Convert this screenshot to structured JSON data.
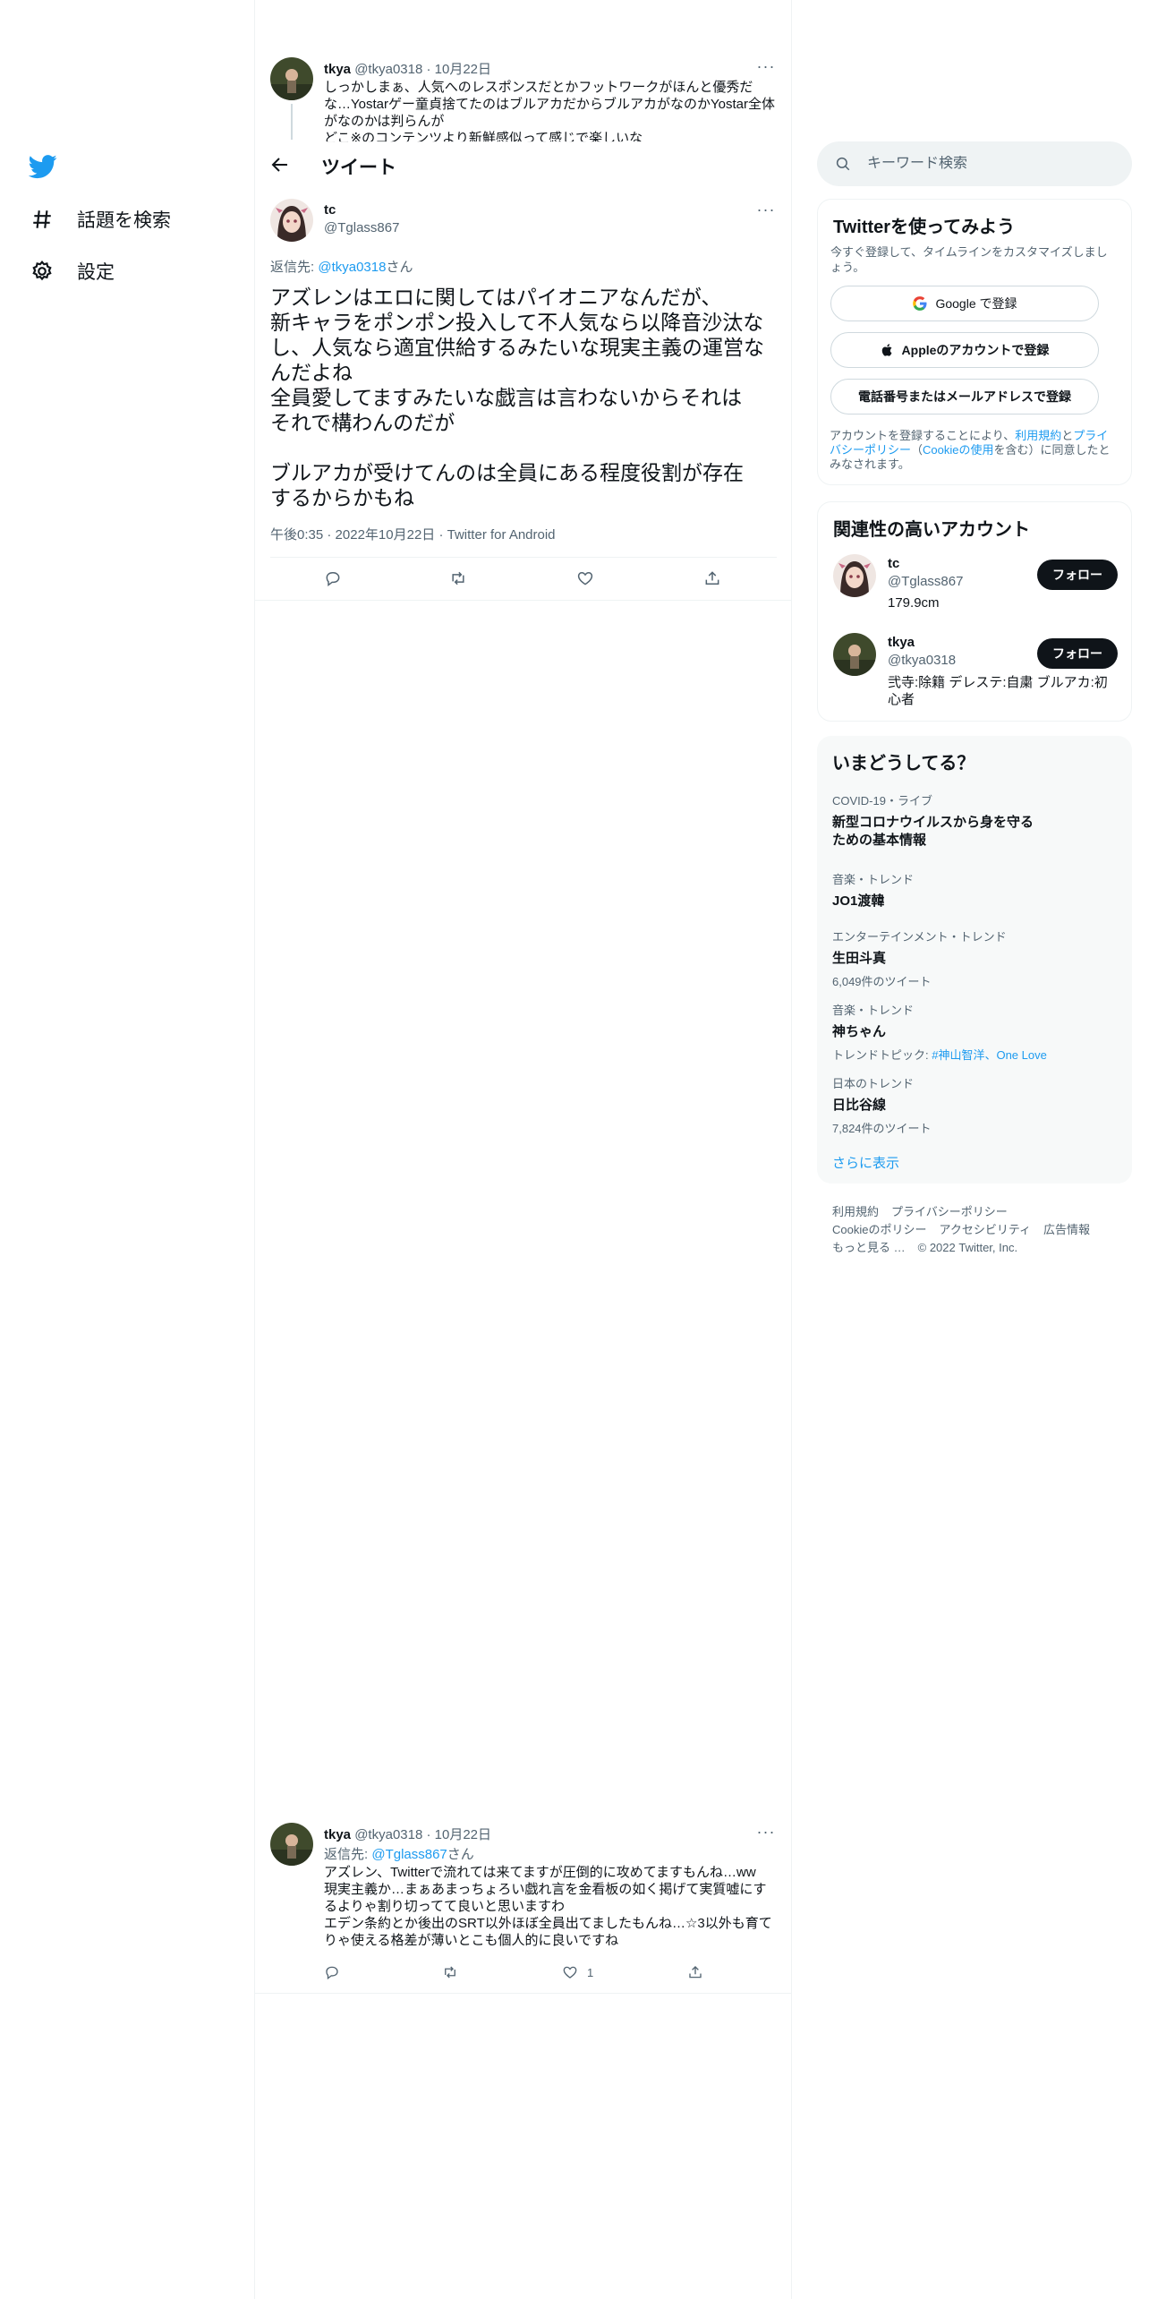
{
  "nav": {
    "explore_label": "話題を検索",
    "settings_label": "設定"
  },
  "header": {
    "title": "ツイート"
  },
  "parent_tweet": {
    "name": "tkya",
    "handle": "@tkya0318",
    "date": "10月22日",
    "lines": [
      "しっかしまぁ、人気へのレスポンスだとかフットワークがほんと優秀だ",
      "な…Yostarゲー童貞捨てたのはブルアカだからブルアカがなのかYostar全体",
      "がなのかは判らんが",
      "どこ※のコンテンツより新鮮感似って感じで楽しいな"
    ]
  },
  "main_tweet": {
    "name": "tc",
    "handle": "@Tglass867",
    "reply_prefix": "返信先: ",
    "reply_to": "@tkya0318",
    "reply_suffix": "さん",
    "lines": [
      "アズレンはエロに関してはパイオニアなんだが、",
      "新キャラをポンポン投入して不人気なら以降音沙汰な",
      "し、人気なら適宜供給するみたいな現実主義の運営な",
      "んだよね",
      "全員愛してますみたいな戯言は言わないからそれは",
      "それで構わんのだが",
      "",
      "ブルアカが受けてんのは全員にある程度役割が存在",
      "するからかもね"
    ],
    "time": "午後0:35",
    "date": "2022年10月22日",
    "source": "Twitter for Android"
  },
  "reply_tweet": {
    "name": "tkya",
    "handle": "@tkya0318",
    "date": "10月22日",
    "reply_prefix": "返信先: ",
    "reply_to": "@Tglass867",
    "reply_suffix": "さん",
    "lines": [
      "アズレン、Twitterで流れては来てますが圧倒的に攻めてますもんね…ww",
      "現実主義か…まぁあまっちょろい戯れ言を金看板の如く掲げて実質嘘にす",
      "るよりゃ割り切ってて良いと思いますわ",
      "エデン条約とか後出のSRT以外ほぼ全員出てましたもんね…☆3以外も育て",
      "りゃ使える格差が薄いとこも個人的に良いですね"
    ],
    "like_count": "1"
  },
  "search": {
    "placeholder": "キーワード検索"
  },
  "signup": {
    "title": "Twitterを使ってみよう",
    "subtitle_1": "今すぐ登録して、タイムラインをカスタマイズしまし",
    "subtitle_2": "ょう。",
    "google_label": "Google で登録",
    "apple_label": "Appleのアカウントで登録",
    "phone_label": "電話番号またはメールアドレスで登録",
    "terms_1a": "アカウントを登録することにより、",
    "terms_1b": "利用規約",
    "terms_1c": "と",
    "terms_1d": "プライ",
    "terms_2a": "バシーポリシー",
    "terms_2b": "（",
    "terms_2c": "Cookieの使用",
    "terms_2d": "を含む）に同意したと",
    "terms_3": "みなされます。"
  },
  "related": {
    "title": "関連性の高いアカウント",
    "accounts": [
      {
        "name": "tc",
        "handle": "@Tglass867",
        "bio": "179.9cm",
        "follow_label": "フォロー"
      },
      {
        "name": "tkya",
        "handle": "@tkya0318",
        "bio_1": "弐寺:除籍 デレステ:自粛 ブルアカ:初",
        "bio_2": "心者",
        "follow_label": "フォロー"
      }
    ]
  },
  "trends": {
    "title": "いまどうしてる？",
    "items": [
      {
        "meta": "COVID-19・ライブ",
        "name_1": "新型コロナウイルスから身を守る",
        "name_2": "ための基本情報"
      },
      {
        "meta": "音楽・トレンド",
        "name": "JO1渡韓"
      },
      {
        "meta": "エンターテインメント・トレンド",
        "name": "生田斗真",
        "sub": "6,049件のツイート"
      },
      {
        "meta": "音楽・トレンド",
        "name": "神ちゃん",
        "sub_prefix": "トレンドトピック: ",
        "sub_links": "#神山智洋、One Love"
      },
      {
        "meta": "日本のトレンド",
        "name": "日比谷線",
        "sub": "7,824件のツイート"
      }
    ],
    "show_more": "さらに表示"
  },
  "footer": {
    "terms": "利用規約",
    "privacy": "プライバシーポリシー",
    "cookie": "Cookieのポリシー",
    "accessibility": "アクセシビリティ",
    "ads": "広告情報",
    "more": "もっと見る …",
    "copyright": "© 2022 Twitter, Inc."
  },
  "colors": {
    "accent": "#1d9bf0",
    "text": "#0f1419",
    "muted": "#536471",
    "border": "#eff3f4"
  }
}
